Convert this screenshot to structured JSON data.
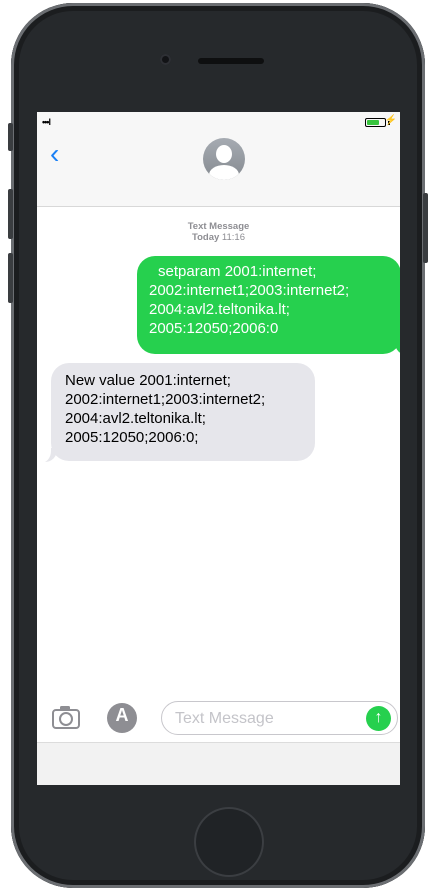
{
  "statusbar": {
    "signal": "•••l",
    "charging": "⚡"
  },
  "header": {
    "back_glyph": "‹"
  },
  "thread": {
    "service_label": "Text Message",
    "date_label": "Today",
    "time_label": "11:16"
  },
  "messages": {
    "sent_lines": [
      "setparam 2001:internet;",
      "2002:internet1;2003:internet2;",
      "2004:avl2.teltonika.lt;",
      "2005:12050;2006:0"
    ],
    "received_lines": [
      "New value 2001:internet;",
      "2002:internet1;2003:internet2;",
      "2004:avl2.teltonika.lt;",
      "2005:12050;2006:0;"
    ]
  },
  "composer": {
    "placeholder": "Text Message",
    "appstore_glyph": "A",
    "send_glyph": "↑"
  },
  "colors": {
    "sent_bubble": "#26d04e",
    "received_bubble": "#e6e6eb",
    "accent_blue": "#1a80f5"
  }
}
